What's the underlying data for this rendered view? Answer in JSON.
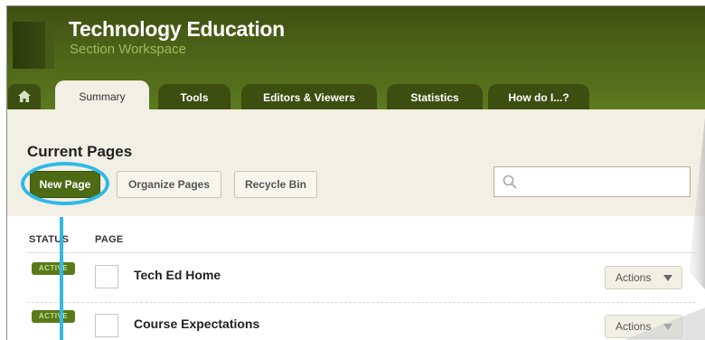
{
  "header": {
    "title": "Technology Education",
    "subtitle": "Section Workspace"
  },
  "tabs": [
    {
      "label": "Summary"
    },
    {
      "label": "Tools"
    },
    {
      "label": "Editors & Viewers"
    },
    {
      "label": "Statistics"
    },
    {
      "label": "How do I...?"
    }
  ],
  "main": {
    "section_title": "Current Pages",
    "buttons": {
      "new_page": "New Page",
      "organize_pages": "Organize Pages",
      "recycle_bin": "Recycle Bin"
    },
    "search": {
      "placeholder": "",
      "value": ""
    },
    "columns": {
      "status": "STATUS",
      "page": "PAGE"
    },
    "rows": [
      {
        "status": "ACTIVE",
        "name": "Tech Ed Home",
        "actions": "Actions"
      },
      {
        "status": "ACTIVE",
        "name": "Course Expectations",
        "actions": "Actions"
      }
    ]
  },
  "colors": {
    "header_green": "#4c6418",
    "button_green": "#4d6a15",
    "highlight_blue": "#2fb9e9",
    "content_bg": "#f2efe4"
  },
  "icons": [
    "home-icon",
    "search-icon",
    "caret-down-icon"
  ]
}
